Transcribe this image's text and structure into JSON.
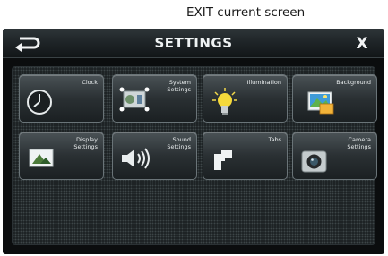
{
  "annotation": {
    "text": "EXIT current screen"
  },
  "header": {
    "title": "SETTINGS",
    "exit_label": "X"
  },
  "tiles": [
    {
      "label": "Clock",
      "icon": "clock-icon"
    },
    {
      "label": "System\nSettings",
      "icon": "system-settings-icon"
    },
    {
      "label": "Illumination",
      "icon": "lightbulb-icon"
    },
    {
      "label": "Background",
      "icon": "background-picture-icon"
    },
    {
      "label": "Display\nSettings",
      "icon": "display-icon"
    },
    {
      "label": "Sound\nSettings",
      "icon": "speaker-icon"
    },
    {
      "label": "Tabs",
      "icon": "tabs-icon"
    },
    {
      "label": "Camera\nSettings",
      "icon": "camera-icon"
    }
  ],
  "colors": {
    "accent": "#e9edee",
    "background": "#0b0d0e"
  }
}
